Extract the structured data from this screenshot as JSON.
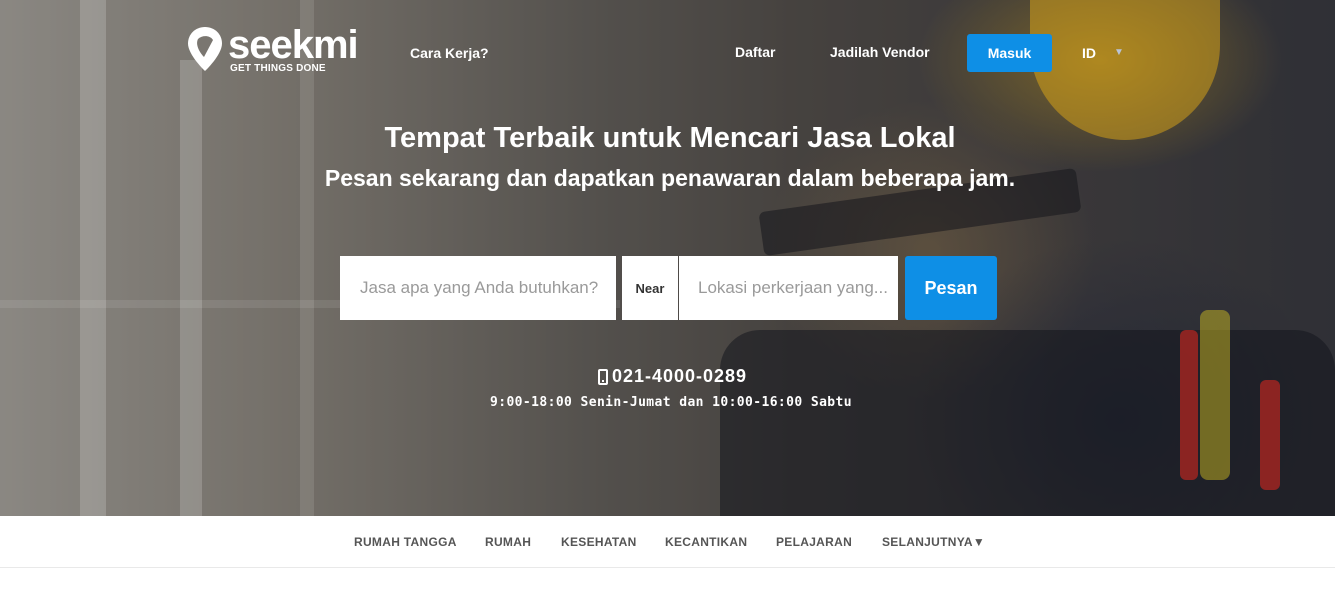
{
  "header": {
    "logo_name": "seekmi",
    "logo_tagline": "GET THINGS DONE",
    "how_it_works": "Cara Kerja?",
    "register": "Daftar",
    "become_vendor": "Jadilah Vendor",
    "login": "Masuk",
    "language": "ID"
  },
  "hero": {
    "headline": "Tempat Terbaik untuk Mencari Jasa Lokal",
    "subheadline": "Pesan sekarang dan dapatkan penawaran dalam beberapa jam."
  },
  "search": {
    "service_placeholder": "Jasa apa yang Anda butuhkan?",
    "near_label": "Near",
    "location_placeholder": "Lokasi perkerjaan yang...",
    "submit": "Pesan"
  },
  "contact": {
    "phone": "021-4000-0289",
    "hours": "9:00-18:00 Senin-Jumat dan 10:00-16:00 Sabtu"
  },
  "categories": [
    "RUMAH TANGGA",
    "RUMAH",
    "KESEHATAN",
    "KECANTIKAN",
    "PELAJARAN",
    "SELANJUTNYA▼"
  ],
  "colors": {
    "accent": "#0e8fe6"
  }
}
